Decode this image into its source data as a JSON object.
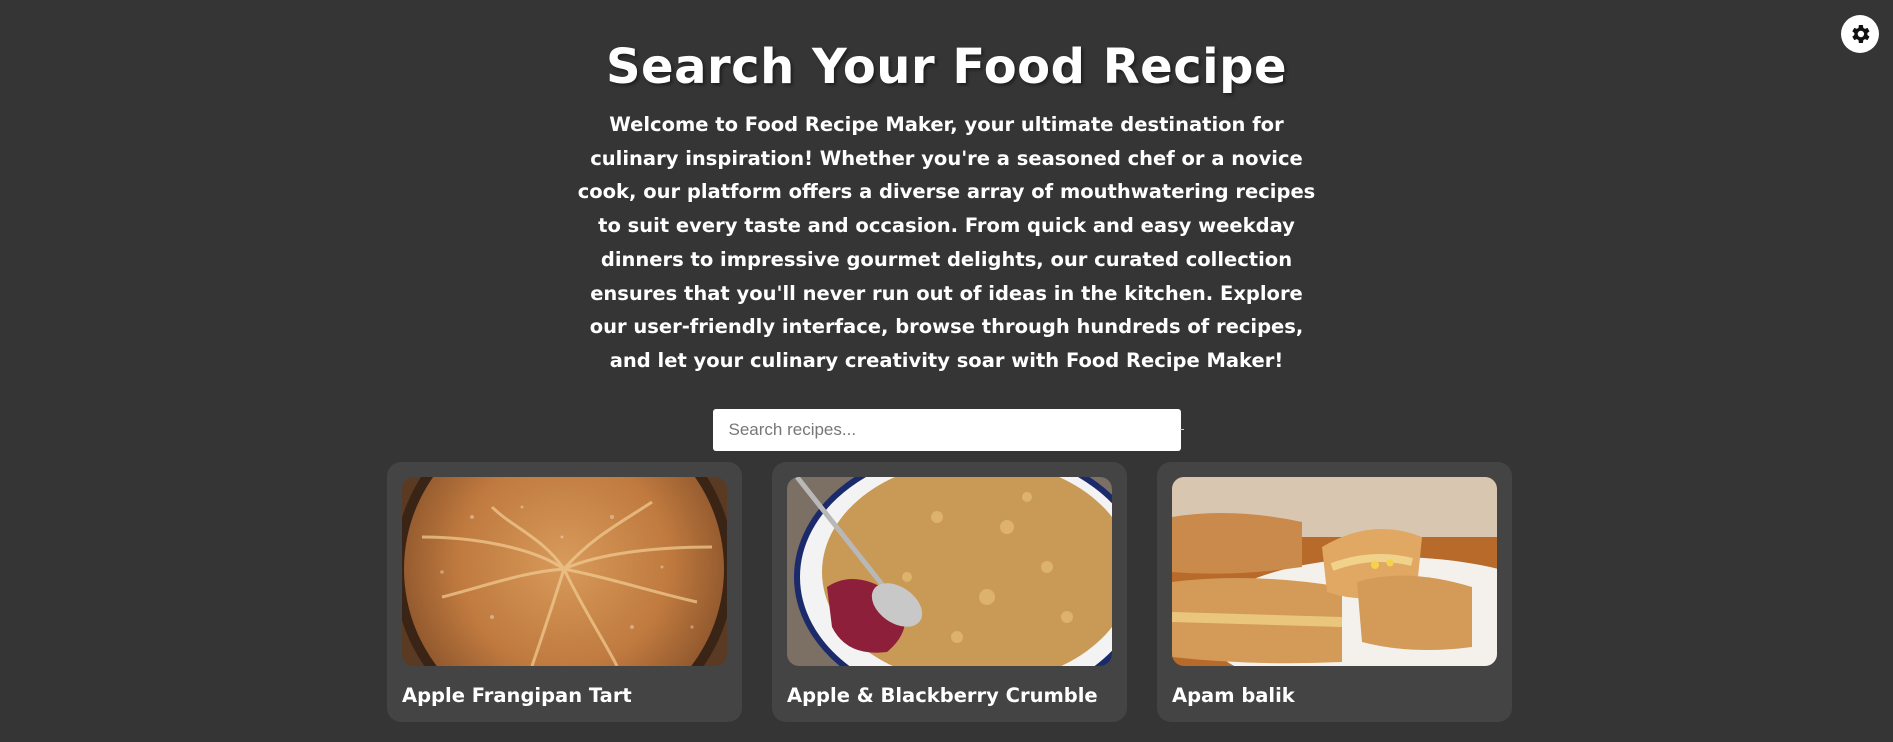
{
  "header": {
    "title": "Search Your Food Recipe",
    "intro": "Welcome to Food Recipe Maker, your ultimate destination for culinary inspiration! Whether you're a seasoned chef or a novice cook, our platform offers a diverse array of mouthwatering recipes to suit every taste and occasion. From quick and easy weekday dinners to impressive gourmet delights, our curated collection ensures that you'll never run out of ideas in the kitchen. Explore our user-friendly interface, browse through hundreds of recipes, and let your culinary creativity soar with Food Recipe Maker!"
  },
  "theme_toggle": {
    "icon": "gear-icon"
  },
  "search": {
    "placeholder": "Search recipes...",
    "value": ""
  },
  "recipes": [
    {
      "title": "Apple Frangipan Tart",
      "image": "apple-tart-photo"
    },
    {
      "title": "Apple & Blackberry Crumble",
      "image": "blackberry-crumble-photo"
    },
    {
      "title": "Apam balik",
      "image": "apam-balik-photo"
    }
  ],
  "colors": {
    "background": "#353535",
    "card": "#444444",
    "text": "#ffffff",
    "input": "#ffffff"
  }
}
